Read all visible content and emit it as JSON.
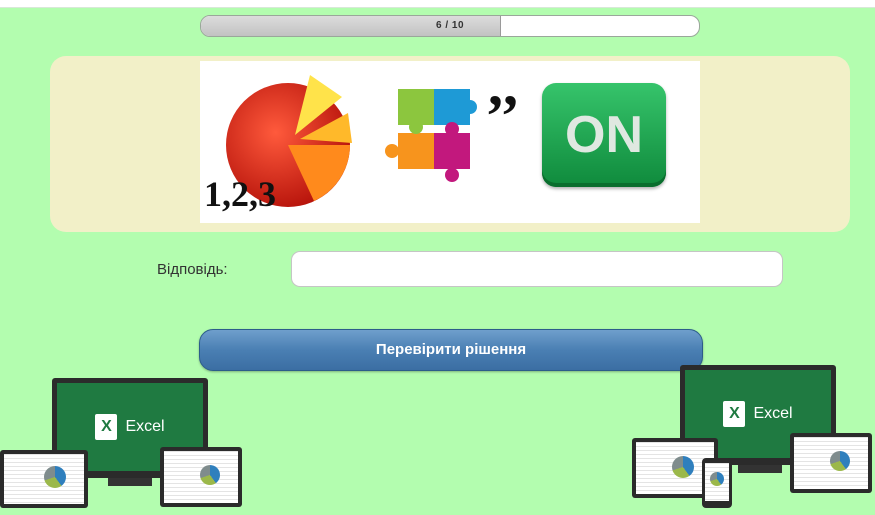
{
  "progress": {
    "current": 6,
    "total": 10,
    "text": "6 / 10",
    "fraction": 0.6
  },
  "puzzle": {
    "numbers_text": "1,2,3",
    "quote_mark": ",,",
    "on_button_text": "ON"
  },
  "answer": {
    "label": "Відповідь:",
    "value": "",
    "placeholder": ""
  },
  "check_button": {
    "label": "Перевірити рішення"
  },
  "decorations": {
    "excel_word": "Excel",
    "excel_logo_letter": "X"
  },
  "colors": {
    "background": "#b3fdaf",
    "panel": "#f2f0c8",
    "button": "#4a7fb3",
    "excel_green": "#1f7a41"
  }
}
